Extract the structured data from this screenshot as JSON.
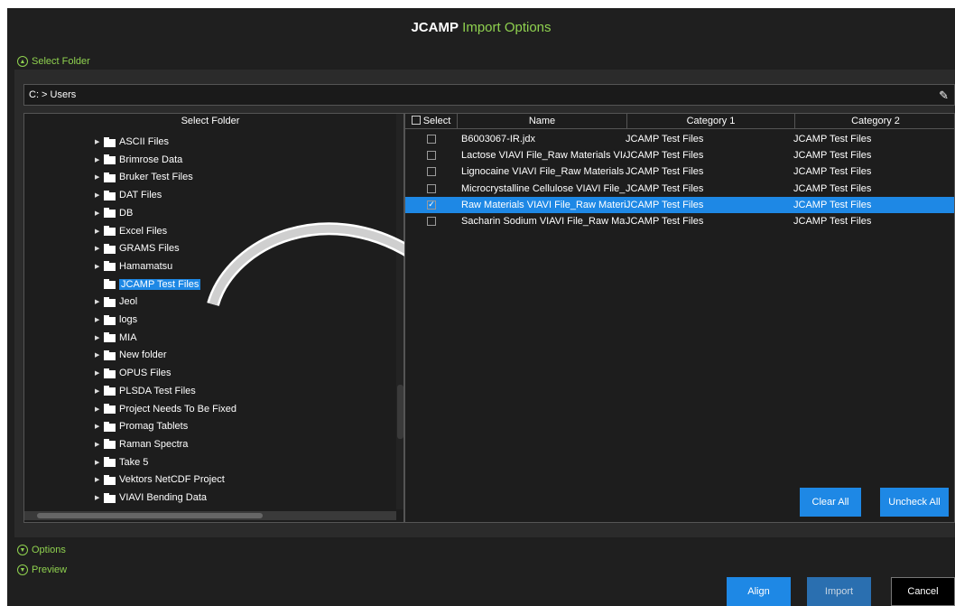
{
  "title": {
    "part1": "JCAMP",
    "part2": "Import Options"
  },
  "sections": {
    "select_folder": "Select Folder",
    "options": "Options",
    "preview": "Preview"
  },
  "path": {
    "value": "C: > Users"
  },
  "tree": {
    "header": "Select Folder",
    "items": [
      {
        "label": "ASCII Files"
      },
      {
        "label": "Brimrose Data"
      },
      {
        "label": "Bruker Test Files"
      },
      {
        "label": "DAT Files"
      },
      {
        "label": "DB"
      },
      {
        "label": "Excel Files"
      },
      {
        "label": "GRAMS Files"
      },
      {
        "label": "Hamamatsu"
      },
      {
        "label": "JCAMP Test Files"
      },
      {
        "label": "Jeol"
      },
      {
        "label": "logs"
      },
      {
        "label": "MIA"
      },
      {
        "label": "New folder"
      },
      {
        "label": "OPUS Files"
      },
      {
        "label": "PLSDA Test Files"
      },
      {
        "label": "Project Needs To Be Fixed"
      },
      {
        "label": "Promag Tablets"
      },
      {
        "label": "Raman Spectra"
      },
      {
        "label": "Take 5"
      },
      {
        "label": "Vektors NetCDF Project"
      },
      {
        "label": "VIAVI Bending Data"
      }
    ],
    "selected_index": 8
  },
  "files": {
    "columns": {
      "select": "Select",
      "name": "Name",
      "category1": "Category 1",
      "category2": "Category 2"
    },
    "rows": [
      {
        "name": "B6003067-IR.jdx",
        "category1": "JCAMP Test Files",
        "category2": "JCAMP Test Files",
        "checked": false
      },
      {
        "name": "Lactose VIAVI File_Raw Materials VIA",
        "category1": "JCAMP Test Files",
        "category2": "JCAMP Test Files",
        "checked": false
      },
      {
        "name": "Lignocaine VIAVI File_Raw Materials '",
        "category1": "JCAMP Test Files",
        "category2": "JCAMP Test Files",
        "checked": false
      },
      {
        "name": "Microcrystalline Cellulose VIAVI File_I",
        "category1": "JCAMP Test Files",
        "category2": "JCAMP Test Files",
        "checked": false
      },
      {
        "name": "Raw Materials VIAVI File_Raw Materia",
        "category1": "JCAMP Test Files",
        "category2": "JCAMP Test Files",
        "checked": true
      },
      {
        "name": "Sacharin Sodium VIAVI File_Raw Mat",
        "category1": "JCAMP Test Files",
        "category2": "JCAMP Test Files",
        "checked": false
      }
    ],
    "selected_index": 4
  },
  "buttons": {
    "clear_all": "Clear All",
    "uncheck_all": "Uncheck All",
    "align": "Align",
    "import": "Import",
    "cancel": "Cancel"
  },
  "colors": {
    "accent": "#8fd14f",
    "selection": "#1e88e5",
    "background": "#1f1f1f"
  }
}
